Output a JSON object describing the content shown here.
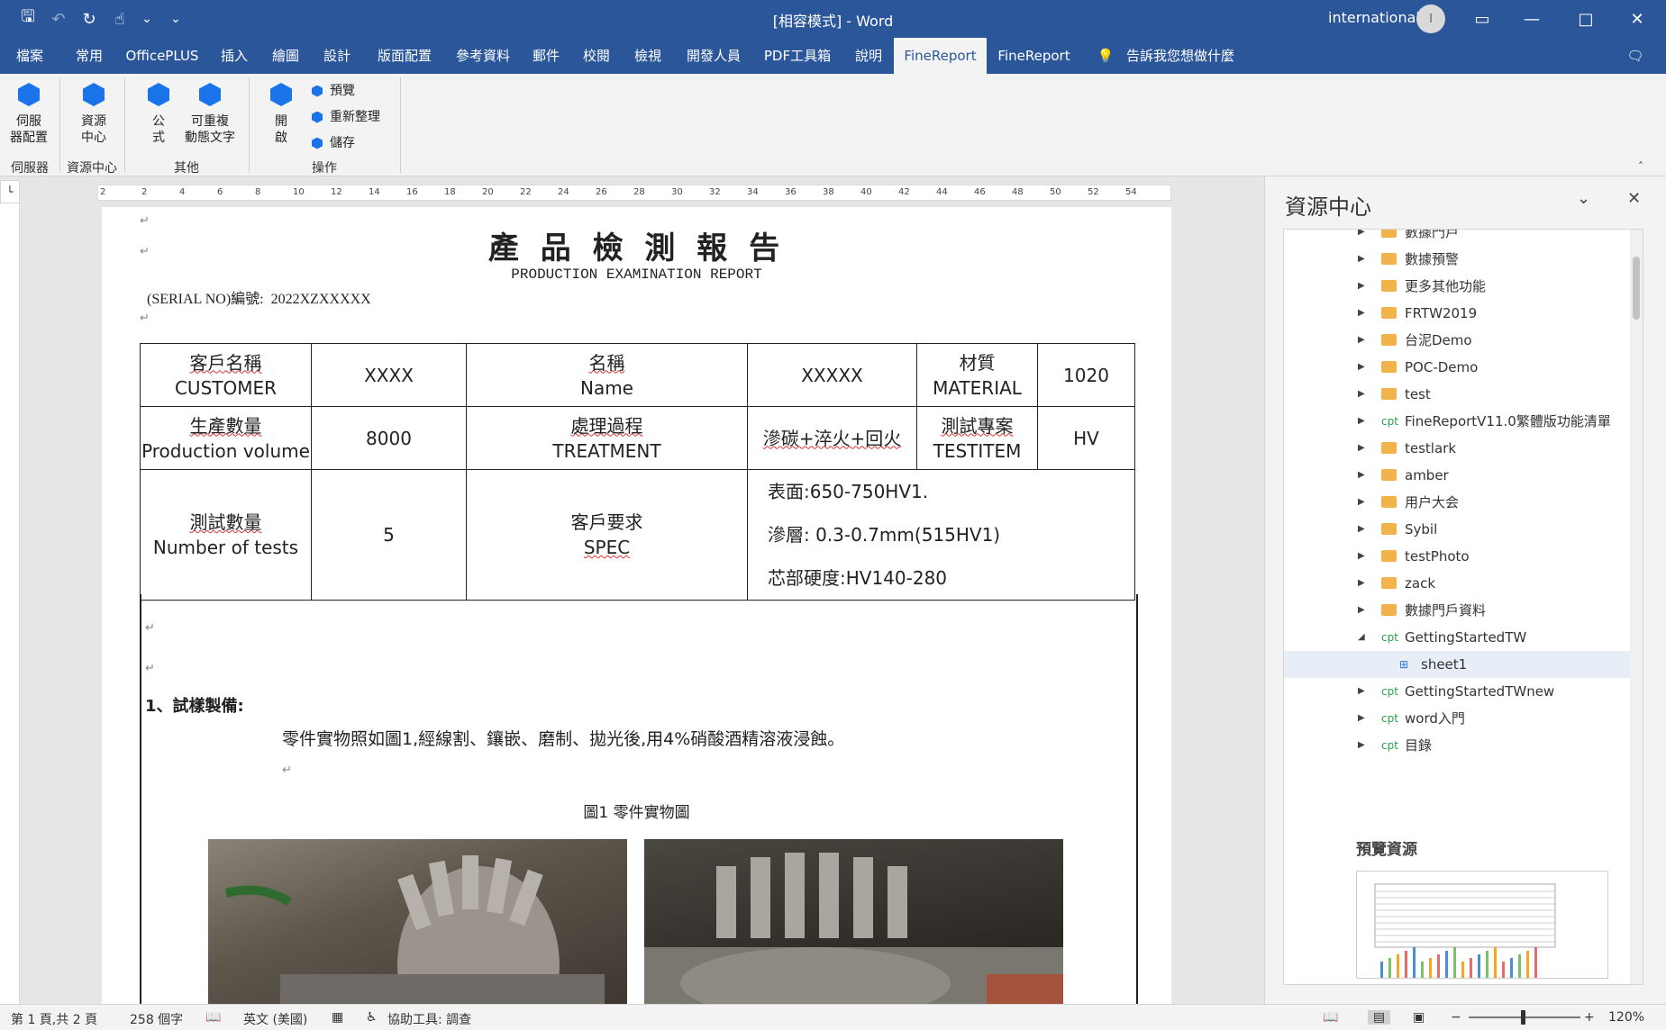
{
  "window": {
    "title": "[相容模式] - Word",
    "user": "international",
    "avatar_initial": "I"
  },
  "quick_access": [
    {
      "name": "save-icon",
      "glyph": "🖫"
    },
    {
      "name": "undo-icon",
      "glyph": "↶"
    },
    {
      "name": "redo-icon",
      "glyph": "↻"
    },
    {
      "name": "touch-mode-icon",
      "glyph": "☝"
    },
    {
      "name": "customize-icon",
      "glyph": "⌄"
    }
  ],
  "menu_tabs": [
    "檔案",
    "常用",
    "OfficePLUS",
    "插入",
    "繪圖",
    "設計",
    "版面配置",
    "參考資料",
    "郵件",
    "校閱",
    "檢視",
    "開發人員",
    "PDF工具箱",
    "說明",
    "FineReport",
    "FineReport",
    "告訴我您想做什麼"
  ],
  "active_tab_index": 14,
  "ribbon": {
    "buttons": [
      {
        "line1": "伺服",
        "line2": "器配置"
      },
      {
        "line1": "資源",
        "line2": "中心"
      },
      {
        "line1": "公",
        "line2": "式"
      },
      {
        "line1": "可重複",
        "line2": "動態文字"
      },
      {
        "line1": "開",
        "line2": "啟"
      }
    ],
    "small_buttons": [
      "預覽",
      "重新整理",
      "儲存"
    ],
    "groups": [
      "伺服器",
      "資源中心",
      "其他",
      "操作"
    ]
  },
  "ruler": {
    "marks": [
      "2",
      "2",
      "4",
      "6",
      "8",
      "10",
      "12",
      "14",
      "16",
      "18",
      "20",
      "22",
      "24",
      "26",
      "28",
      "30",
      "32",
      "34",
      "36",
      "38",
      "40",
      "42",
      "44",
      "46",
      "48",
      "50",
      "52",
      "54"
    ]
  },
  "document": {
    "title": "產 品 檢 測 報 告",
    "subtitle": "PRODUCTION EXAMINATION REPORT",
    "serial_label": "(SERIAL NO)編號:",
    "serial_value": "2022XZXXXXX",
    "table": {
      "r1": {
        "c1a": "客戶名稱",
        "c1b": "CUSTOMER",
        "c2": "XXXX",
        "c3a": "名稱",
        "c3b": "Name",
        "c4": "XXXXX",
        "c5a": "材質",
        "c5b": "MATERIAL",
        "c6": "1020"
      },
      "r2": {
        "c1a": "生產數量",
        "c1b": "Production volume",
        "c2": "8000",
        "c3a": "處理過程",
        "c3b": "TREATMENT",
        "c4": "滲碳+淬火+回火",
        "c5a": "測試專案",
        "c5b": "TESTITEM",
        "c6": "HV"
      },
      "r3": {
        "c1a": "測試數量",
        "c1b": "Number of tests",
        "c2": "5",
        "c3a": "客戶要求",
        "c3b": "SPEC",
        "spec1": "表面:650-750HV1.",
        "spec2": "滲層: 0.3-0.7mm(515HV1)",
        "spec3": "芯部硬度:HV140-280"
      }
    },
    "section1_title": "1、試樣製備:",
    "section1_text": "零件實物照如圖1,經線割、鑲嵌、磨制、拋光後,用4%硝酸酒精溶液浸蝕。",
    "figure_caption": "圖1 零件實物圖"
  },
  "side_panel": {
    "title": "資源中心",
    "tree": [
      {
        "label": "數據門戶",
        "kind": "folder",
        "arrow": "▶",
        "indent": 0
      },
      {
        "label": "數據預警",
        "kind": "folder",
        "arrow": "▶",
        "indent": 0
      },
      {
        "label": "更多其他功能",
        "kind": "folder",
        "arrow": "▶",
        "indent": 0
      },
      {
        "label": "FRTW2019",
        "kind": "folder",
        "arrow": "▶",
        "indent": 0
      },
      {
        "label": "台泥Demo",
        "kind": "folder",
        "arrow": "▶",
        "indent": 0
      },
      {
        "label": "POC-Demo",
        "kind": "folder",
        "arrow": "▶",
        "indent": 0
      },
      {
        "label": "test",
        "kind": "folder",
        "arrow": "▶",
        "indent": 0
      },
      {
        "label": "FineReportV11.0繁體版功能清單",
        "kind": "cpt",
        "arrow": "▶",
        "indent": 0
      },
      {
        "label": "testlark",
        "kind": "folder",
        "arrow": "▶",
        "indent": 0
      },
      {
        "label": "amber",
        "kind": "folder",
        "arrow": "▶",
        "indent": 0
      },
      {
        "label": "用户大会",
        "kind": "folder",
        "arrow": "▶",
        "indent": 0
      },
      {
        "label": "Sybil",
        "kind": "folder",
        "arrow": "▶",
        "indent": 0
      },
      {
        "label": "testPhoto",
        "kind": "folder",
        "arrow": "▶",
        "indent": 0
      },
      {
        "label": "zack",
        "kind": "folder",
        "arrow": "▶",
        "indent": 0
      },
      {
        "label": "數據門戶資料",
        "kind": "folder",
        "arrow": "▶",
        "indent": 0
      },
      {
        "label": "GettingStartedTW",
        "kind": "cpt",
        "arrow": "◢",
        "indent": 0
      },
      {
        "label": "sheet1",
        "kind": "sheet",
        "arrow": "",
        "indent": 1
      },
      {
        "label": "GettingStartedTWnew",
        "kind": "cpt",
        "arrow": "▶",
        "indent": 0
      },
      {
        "label": "word入門",
        "kind": "cpt",
        "arrow": "▶",
        "indent": 0
      },
      {
        "label": "目錄",
        "kind": "cpt",
        "arrow": "▶",
        "indent": 0
      }
    ],
    "cpt_tag": "cpt",
    "preview_title": "預覽資源"
  },
  "status": {
    "page": "第 1 頁,共 2 頁",
    "words": "258 個字",
    "language": "英文 (美國)",
    "accessibility": "協助工具: 調查",
    "zoom": "120%"
  }
}
